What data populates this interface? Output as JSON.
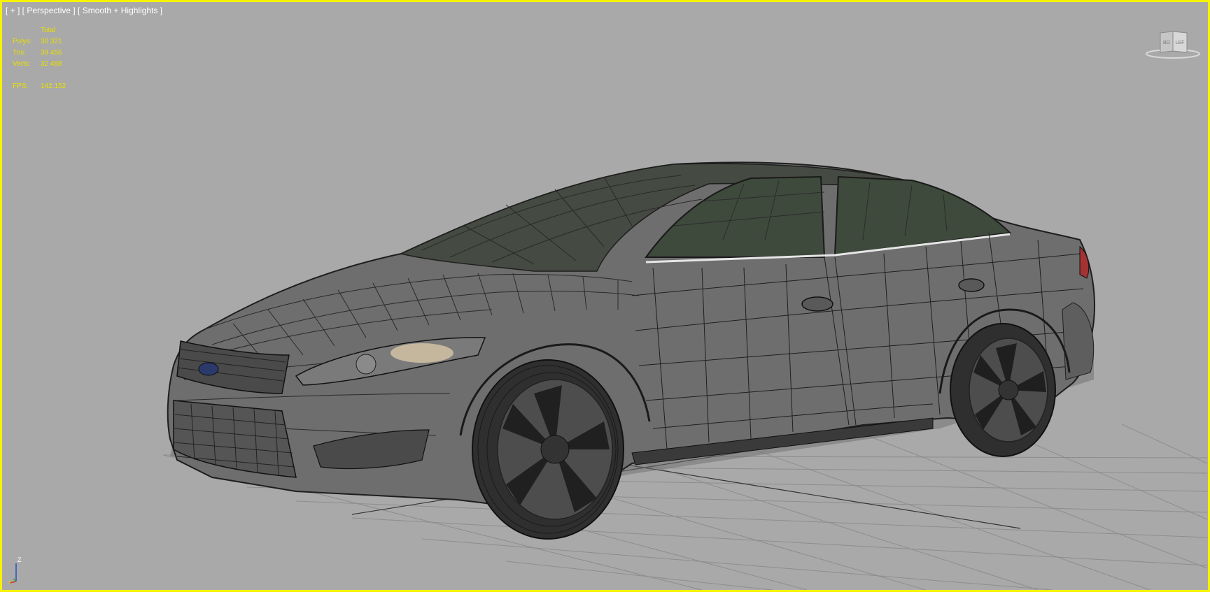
{
  "viewport": {
    "label": "[ + ] [ Perspective ] [ Smooth + Highlights ]",
    "border_color": "#f7f200",
    "background_color": "#a9a9a9"
  },
  "stats": {
    "header": "Total",
    "rows": [
      {
        "key": "Polys:",
        "value": "30 321"
      },
      {
        "key": "Tris:",
        "value": "39 456"
      },
      {
        "key": "Verts:",
        "value": "32 488"
      }
    ],
    "fps_key": "FPS:",
    "fps_value": "142.152"
  },
  "viewcube": {
    "left_face": "BO",
    "right_face": "LEF",
    "icon": "viewcube-icon"
  },
  "axis_gizmo": {
    "z_label": "Z",
    "x_label": "x",
    "icon": "axis-tripod-icon"
  },
  "scene": {
    "object": "car-wireframe-model",
    "grid": "ground-grid"
  }
}
